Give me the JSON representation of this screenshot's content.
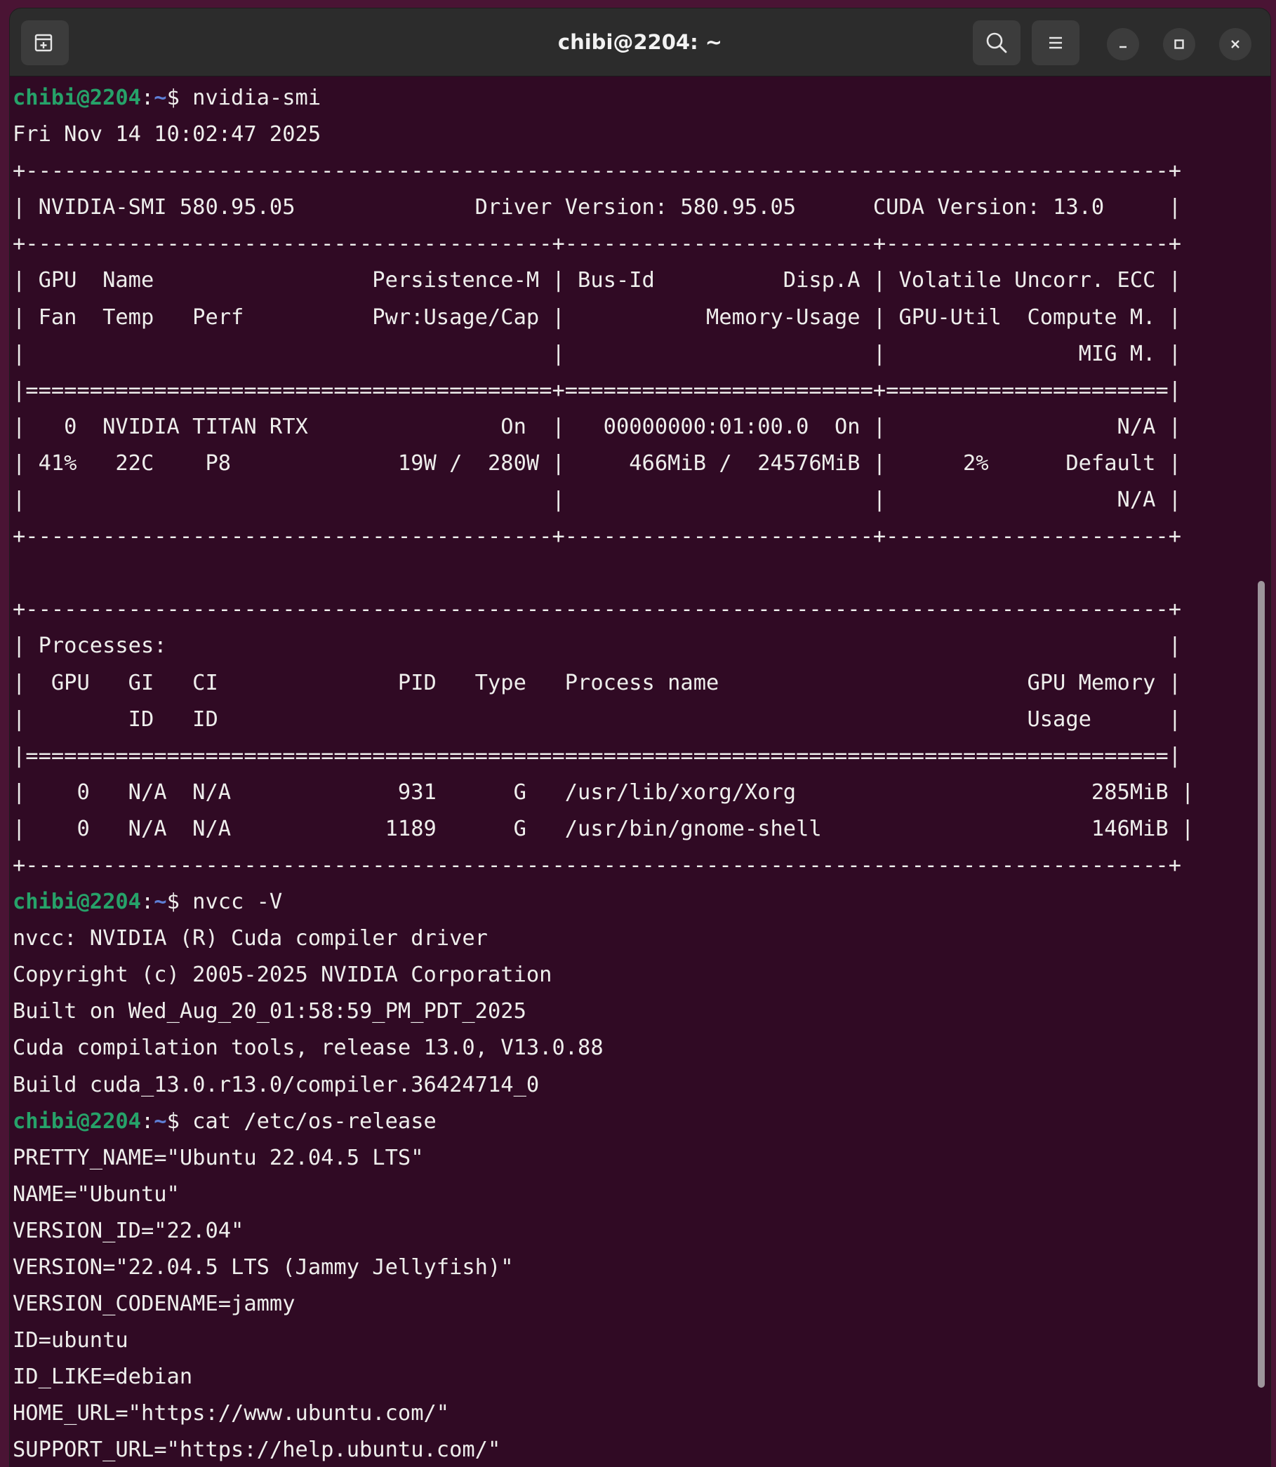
{
  "window": {
    "title": "chibi@2204: ~"
  },
  "titlebar": {
    "new_tab_icon": "new-tab-icon",
    "search_icon": "search-icon",
    "menu_icon": "hamburger-menu-icon",
    "minimize_icon": "minimize-icon",
    "maximize_icon": "maximize-icon",
    "close_icon": "close-icon"
  },
  "prompt": {
    "user": "chibi@2204",
    "sep": ":",
    "path": "~",
    "symbol": "$ "
  },
  "colors": {
    "terminal_bg": "#300a24",
    "prompt_user": "#26a269",
    "prompt_path": "#5e7fd6",
    "text": "#eeeeec"
  },
  "terminal": {
    "lines": [
      {
        "type": "prompt",
        "command": "nvidia-smi"
      },
      {
        "type": "out",
        "text": "Fri Nov 14 10:02:47 2025"
      },
      {
        "type": "out",
        "text": "+-----------------------------------------------------------------------------------------+"
      },
      {
        "type": "out",
        "text": "| NVIDIA-SMI 580.95.05              Driver Version: 580.95.05      CUDA Version: 13.0     |"
      },
      {
        "type": "out",
        "text": "+-----------------------------------------+------------------------+----------------------+"
      },
      {
        "type": "out",
        "text": "| GPU  Name                 Persistence-M | Bus-Id          Disp.A | Volatile Uncorr. ECC |"
      },
      {
        "type": "out",
        "text": "| Fan  Temp   Perf          Pwr:Usage/Cap |           Memory-Usage | GPU-Util  Compute M. |"
      },
      {
        "type": "out",
        "text": "|                                         |                        |               MIG M. |"
      },
      {
        "type": "out",
        "text": "|=========================================+========================+======================|"
      },
      {
        "type": "out",
        "text": "|   0  NVIDIA TITAN RTX               On  |   00000000:01:00.0  On |                  N/A |"
      },
      {
        "type": "out",
        "text": "| 41%   22C    P8             19W /  280W |     466MiB /  24576MiB |      2%      Default |"
      },
      {
        "type": "out",
        "text": "|                                         |                        |                  N/A |"
      },
      {
        "type": "out",
        "text": "+-----------------------------------------+------------------------+----------------------+"
      },
      {
        "type": "out",
        "text": ""
      },
      {
        "type": "out",
        "text": "+-----------------------------------------------------------------------------------------+"
      },
      {
        "type": "out",
        "text": "| Processes:                                                                              |"
      },
      {
        "type": "out",
        "text": "|  GPU   GI   CI              PID   Type   Process name                        GPU Memory |"
      },
      {
        "type": "out",
        "text": "|        ID   ID                                                               Usage      |"
      },
      {
        "type": "out",
        "text": "|=========================================================================================|"
      },
      {
        "type": "out",
        "text": "|    0   N/A  N/A             931      G   /usr/lib/xorg/Xorg                       285MiB |"
      },
      {
        "type": "out",
        "text": "|    0   N/A  N/A            1189      G   /usr/bin/gnome-shell                     146MiB |"
      },
      {
        "type": "out",
        "text": "+-----------------------------------------------------------------------------------------+"
      },
      {
        "type": "prompt",
        "command": "nvcc -V"
      },
      {
        "type": "out",
        "text": "nvcc: NVIDIA (R) Cuda compiler driver"
      },
      {
        "type": "out",
        "text": "Copyright (c) 2005-2025 NVIDIA Corporation"
      },
      {
        "type": "out",
        "text": "Built on Wed_Aug_20_01:58:59_PM_PDT_2025"
      },
      {
        "type": "out",
        "text": "Cuda compilation tools, release 13.0, V13.0.88"
      },
      {
        "type": "out",
        "text": "Build cuda_13.0.r13.0/compiler.36424714_0"
      },
      {
        "type": "prompt",
        "command": "cat /etc/os-release"
      },
      {
        "type": "out",
        "text": "PRETTY_NAME=\"Ubuntu 22.04.5 LTS\""
      },
      {
        "type": "out",
        "text": "NAME=\"Ubuntu\""
      },
      {
        "type": "out",
        "text": "VERSION_ID=\"22.04\""
      },
      {
        "type": "out",
        "text": "VERSION=\"22.04.5 LTS (Jammy Jellyfish)\""
      },
      {
        "type": "out",
        "text": "VERSION_CODENAME=jammy"
      },
      {
        "type": "out",
        "text": "ID=ubuntu"
      },
      {
        "type": "out",
        "text": "ID_LIKE=debian"
      },
      {
        "type": "out",
        "text": "HOME_URL=\"https://www.ubuntu.com/\""
      },
      {
        "type": "out",
        "text": "SUPPORT_URL=\"https://help.ubuntu.com/\""
      }
    ]
  }
}
